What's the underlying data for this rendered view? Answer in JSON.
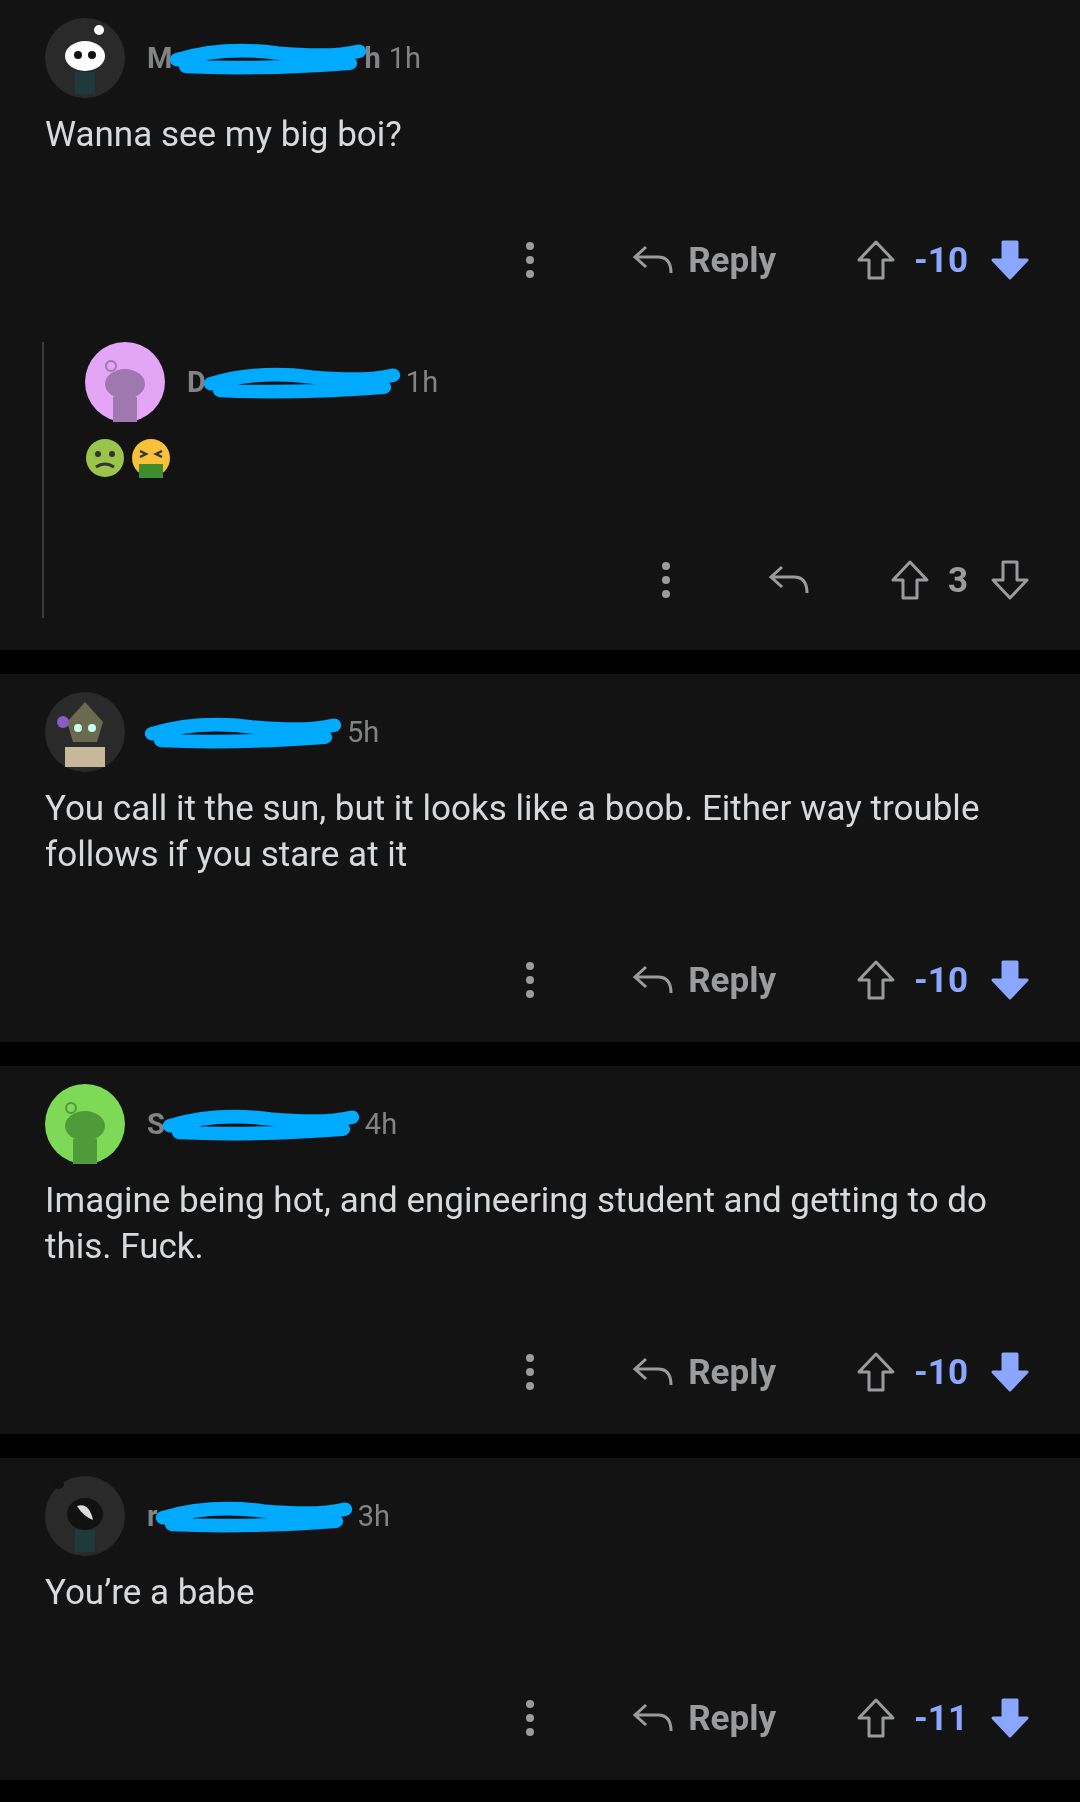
{
  "comments": [
    {
      "avatar": {
        "kind": "white-snoo"
      },
      "name_visible": [
        "M",
        "h"
      ],
      "time": "1h",
      "body": "Wanna see my big boi?",
      "reply_label": "Reply",
      "score": "-10",
      "downvoted": true,
      "replies": [
        {
          "avatar": {
            "kind": "pink-snoo"
          },
          "name_visible": [
            "D"
          ],
          "time": "1h",
          "body_icons": [
            {
              "kind": "nauseated"
            },
            {
              "kind": "vomiting"
            }
          ],
          "score": "3",
          "downvoted": false
        }
      ]
    },
    {
      "avatar": {
        "kind": "armored"
      },
      "time": "5h",
      "body": "You call it the sun, but it looks like a boob. Either way trouble follows if you stare at it",
      "reply_label": "Reply",
      "score": "-10",
      "downvoted": true
    },
    {
      "avatar": {
        "kind": "green-snoo"
      },
      "name_visible": [
        "S"
      ],
      "time": "4h",
      "body": "Imagine being hot, and engineering student and getting to do this. Fuck.",
      "reply_label": "Reply",
      "score": "-10",
      "downvoted": true
    },
    {
      "avatar": {
        "kind": "dark-snoo"
      },
      "name_visible": [
        "r"
      ],
      "time": "3h",
      "body": "You’re a babe",
      "reply_label": "Reply",
      "score": "-11",
      "downvoted": true
    }
  ]
}
